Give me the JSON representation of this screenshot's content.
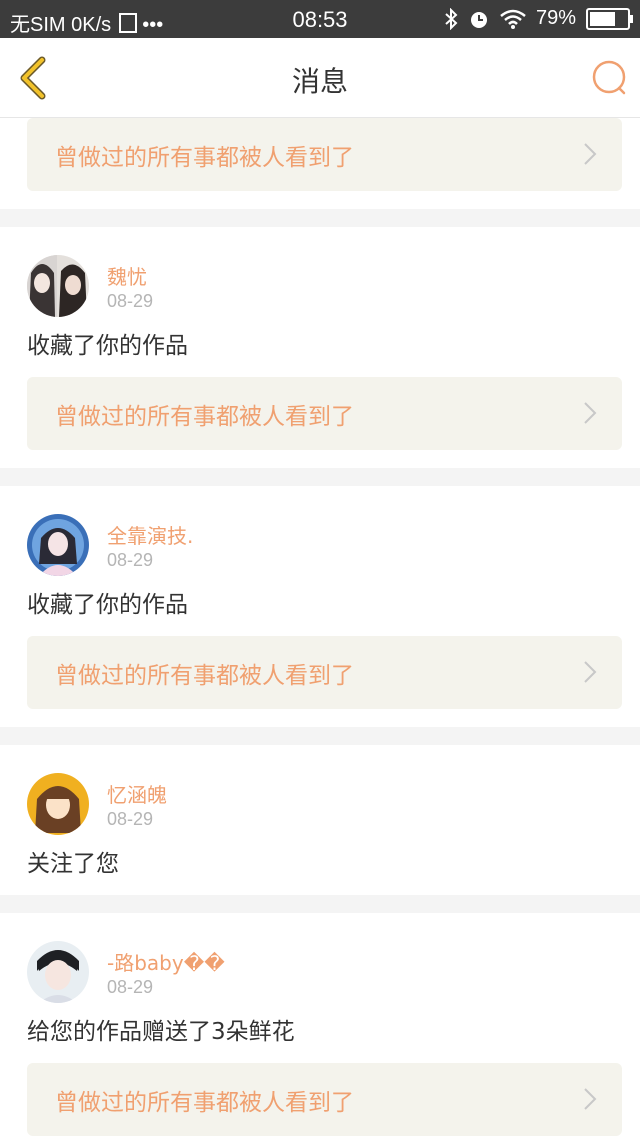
{
  "status_bar": {
    "carrier": "无SIM",
    "speed": "0K/s",
    "dots": "•••",
    "time": "08:53",
    "battery": "79%",
    "battery_level": 0.79
  },
  "header": {
    "title": "消息"
  },
  "colors": {
    "accent": "#f0a070",
    "back": "#f2c22a",
    "link_bg": "#f4f3ec"
  },
  "top_card": {
    "work_title": "曾做过的所有事都被人看到了"
  },
  "messages": [
    {
      "name": "魏忧",
      "date": "08-29",
      "action": "收藏了你的作品",
      "work_title": "曾做过的所有事都被人看到了"
    },
    {
      "name": "全靠演技.",
      "date": "08-29",
      "action": "收藏了你的作品",
      "work_title": "曾做过的所有事都被人看到了"
    },
    {
      "name": "忆涵魄",
      "date": "08-29",
      "action": "关注了您"
    },
    {
      "name": "-路baby��",
      "date": "08-29",
      "action": "给您的作品赠送了3朵鲜花",
      "work_title": "曾做过的所有事都被人看到了"
    }
  ]
}
